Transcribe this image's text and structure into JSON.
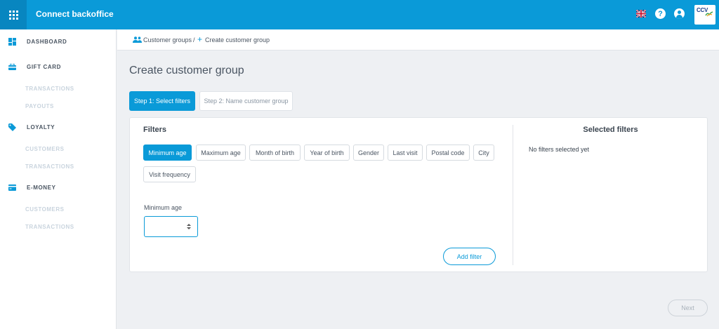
{
  "app": {
    "title": "Connect backoffice"
  },
  "header": {
    "icons": [
      "apps-grid-icon",
      "uk-flag-icon",
      "help-icon",
      "user-icon",
      "ccv-logo"
    ],
    "help_glyph": "?",
    "logo_text": "CCV"
  },
  "sidebar": {
    "sections": [
      {
        "label": "DASHBOARD",
        "icon": "dashboard-icon",
        "items": []
      },
      {
        "label": "GIFT CARD",
        "icon": "gift-card-icon",
        "items": [
          "TRANSACTIONS",
          "PAYOUTS"
        ]
      },
      {
        "label": "LOYALTY",
        "icon": "loyalty-tag-icon",
        "items": [
          "CUSTOMERS",
          "TRANSACTIONS"
        ]
      },
      {
        "label": "E-MONEY",
        "icon": "credit-card-icon",
        "items": [
          "CUSTOMERS",
          "TRANSACTIONS"
        ]
      }
    ]
  },
  "breadcrumb": {
    "parent": "Customer groups",
    "separator": "/",
    "current": "Create customer group"
  },
  "page": {
    "title": "Create customer group"
  },
  "steps": [
    {
      "label": "Step 1: Select filters",
      "active": true
    },
    {
      "label": "Step 2: Name customer group",
      "active": false
    }
  ],
  "filters": {
    "title": "Filters",
    "chips": [
      {
        "label": "Minimum age",
        "active": true
      },
      {
        "label": "Maximum age",
        "active": false
      },
      {
        "label": "Month of birth",
        "active": false
      },
      {
        "label": "Year of birth",
        "active": false
      },
      {
        "label": "Gender",
        "active": false
      },
      {
        "label": "Last visit",
        "active": false
      },
      {
        "label": "Postal code",
        "active": false
      },
      {
        "label": "City",
        "active": false
      },
      {
        "label": "Visit frequency",
        "active": false
      }
    ],
    "field_label": "Minimum age",
    "field_value": "",
    "add_button": "Add filter"
  },
  "selected": {
    "title": "Selected filters",
    "empty_text": "No filters selected yet"
  },
  "footer": {
    "next_button": "Next"
  },
  "colors": {
    "accent": "#0a9ad8",
    "background": "#eef0f3",
    "text": "#4a5562"
  }
}
